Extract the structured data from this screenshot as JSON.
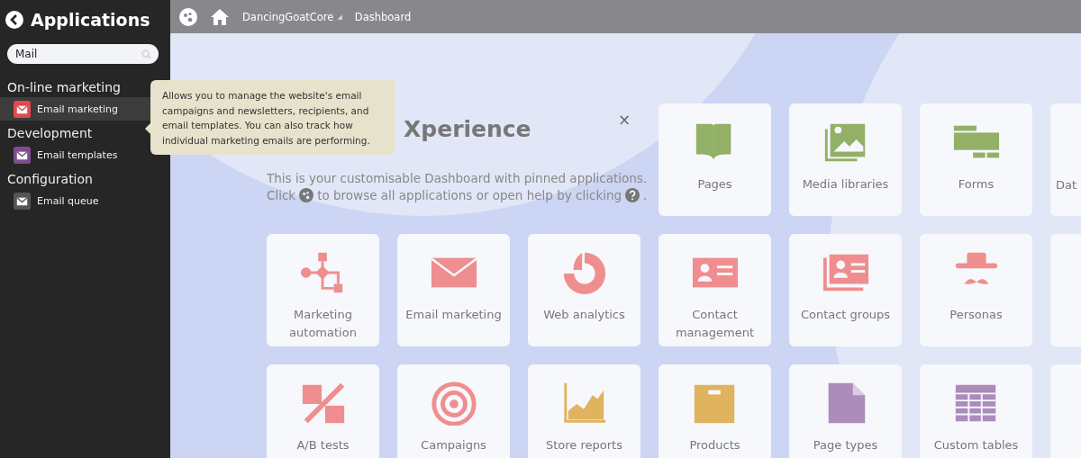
{
  "sidebar": {
    "title": "Applications",
    "search": {
      "value": "Mail"
    },
    "categories": [
      {
        "name": "On-line marketing",
        "items": [
          {
            "label": "Email marketing",
            "color": "#e5484d",
            "selected": true
          }
        ]
      },
      {
        "name": "Development",
        "items": [
          {
            "label": "Email templates",
            "color": "#7e4d8f",
            "selected": false
          }
        ]
      },
      {
        "name": "Configuration",
        "items": [
          {
            "label": "Email queue",
            "color": "#555555",
            "selected": false
          }
        ]
      }
    ]
  },
  "tooltip": {
    "text": "Allows you to manage the website's email campaigns and newsletters, recipients, and email templates. You can also track how individual marketing emails are performing."
  },
  "topbar": {
    "site": "DancingGoatCore",
    "site_caret": "◢",
    "breadcrumb": "Dashboard"
  },
  "welcome": {
    "title": "Xperience",
    "close": "×",
    "line_1": "This is your customisable Dashboard with pinned applications.",
    "line_2": [
      {
        "kind": "text",
        "text": "Click"
      },
      {
        "kind": "apps-icon"
      },
      {
        "kind": "text",
        "text": "to browse all applications or open help by clicking"
      },
      {
        "kind": "help-icon"
      },
      {
        "kind": "text",
        "text": "."
      }
    ]
  },
  "tiles": [
    {
      "kind": "pages",
      "label": "Pages",
      "color": "#93b067"
    },
    {
      "kind": "media",
      "label": "Media libraries",
      "color": "#93b067"
    },
    {
      "kind": "forms",
      "label": "Forms",
      "color": "#93b067"
    },
    {
      "kind": "partial",
      "label": "Dat"
    },
    {
      "kind": "automation",
      "label": "Marketing automation",
      "color": "#ef8e8e"
    },
    {
      "kind": "email",
      "label": "Email marketing",
      "color": "#ef8e8e"
    },
    {
      "kind": "analytics",
      "label": "Web analytics",
      "color": "#ef8e8e"
    },
    {
      "kind": "contact",
      "label": "Contact management",
      "color": "#ef8e8e"
    },
    {
      "kind": "groups",
      "label": "Contact groups",
      "color": "#ef8e8e"
    },
    {
      "kind": "personas",
      "label": "Personas",
      "color": "#ef8e8e"
    },
    {
      "kind": "partial"
    },
    {
      "kind": "abtests",
      "label": "A/B tests",
      "color": "#ef8e8e"
    },
    {
      "kind": "campaigns",
      "label": "Campaigns",
      "color": "#ef8e8e"
    },
    {
      "kind": "reports",
      "label": "Store reports",
      "color": "#e0b35f"
    },
    {
      "kind": "products",
      "label": "Products",
      "color": "#e0b35f"
    },
    {
      "kind": "pagetypes",
      "label": "Page types",
      "color": "#ab8cbb"
    },
    {
      "kind": "tables",
      "label": "Custom tables",
      "color": "#ab8cbb"
    },
    {
      "kind": "partial"
    }
  ]
}
